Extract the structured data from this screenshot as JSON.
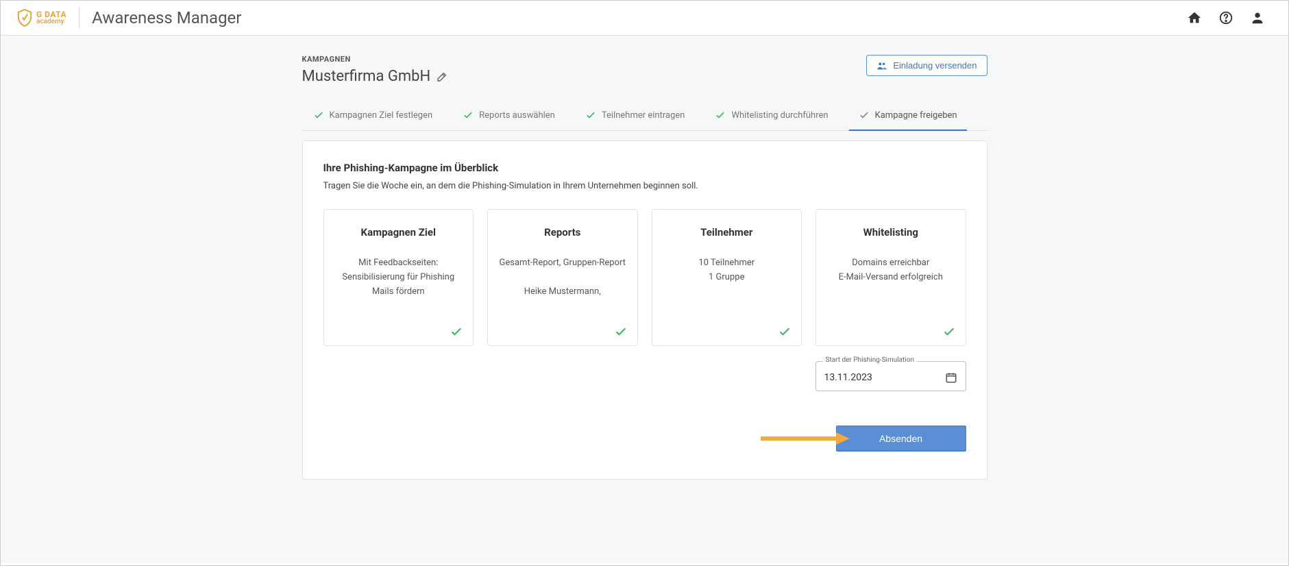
{
  "header": {
    "brand": "G DATA",
    "sub": "academy",
    "app_title": "Awareness Manager"
  },
  "page": {
    "breadcrumb": "KAMPAGNEN",
    "company": "Musterfirma GmbH",
    "invite_label": "Einladung versenden"
  },
  "tabs": [
    {
      "label": "Kampagnen Ziel festlegen",
      "done": true
    },
    {
      "label": "Reports auswählen",
      "done": true
    },
    {
      "label": "Teilnehmer eintragen",
      "done": true
    },
    {
      "label": "Whitelisting durchführen",
      "done": true
    },
    {
      "label": "Kampagne freigeben",
      "done": false,
      "active": true
    }
  ],
  "overview": {
    "title": "Ihre Phishing-Kampagne im Überblick",
    "desc": "Tragen Sie die Woche ein, an dem die Phishing-Simulation in Ihrem Unternehmen beginnen soll."
  },
  "summary": [
    {
      "title": "Kampagnen Ziel",
      "lines": [
        "Mit Feedbackseiten:",
        "Sensibilisierung für Phishing Mails fördern"
      ]
    },
    {
      "title": "Reports",
      "lines": [
        "Gesamt-Report, Gruppen-Report",
        "",
        "Heike Mustermann,"
      ]
    },
    {
      "title": "Teilnehmer",
      "lines": [
        "10 Teilnehmer",
        "1 Gruppe"
      ]
    },
    {
      "title": "Whitelisting",
      "lines": [
        "Domains erreichbar",
        "E-Mail-Versand erfolgreich"
      ]
    }
  ],
  "date": {
    "label": "Start der Phishing-Simulation",
    "value": "13.11.2023"
  },
  "submit_label": "Absenden"
}
